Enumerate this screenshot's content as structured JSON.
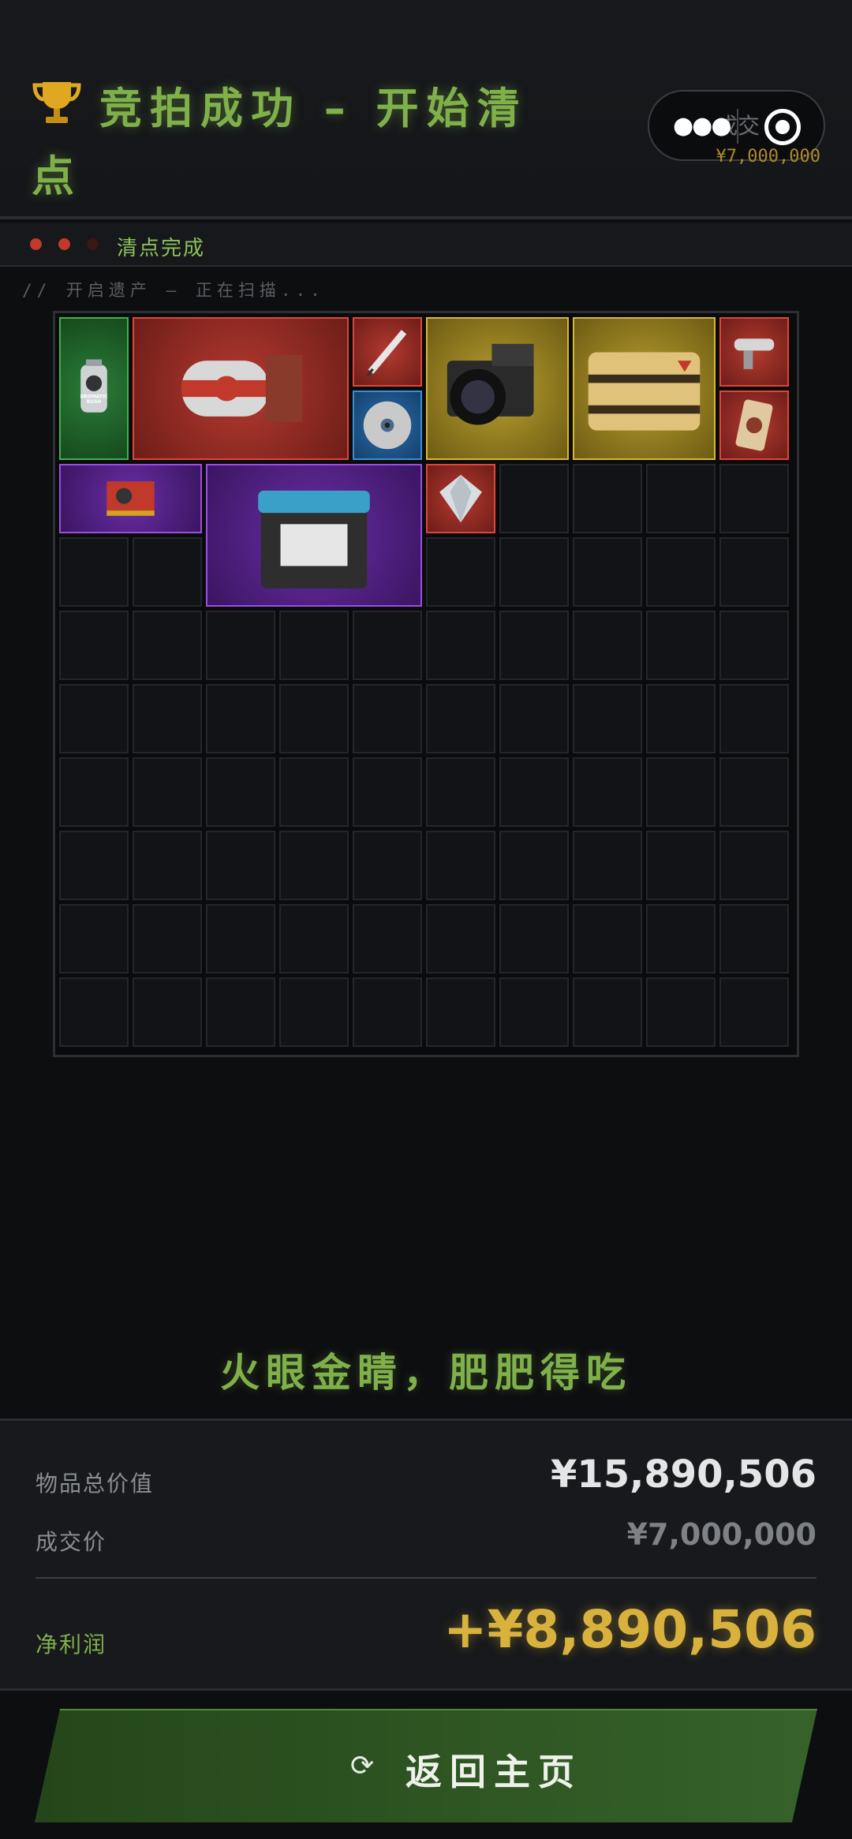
{
  "header": {
    "trophy_icon": "trophy-icon",
    "title": "竞拍成功 – 开始清点",
    "capsule": {
      "more_icon": "more-dots-icon",
      "ghost_text": "成交",
      "close_icon": "target-icon"
    },
    "deal_price_small": "¥7,000,000"
  },
  "status": {
    "dot_colors": [
      "#c0392b",
      "#c0392b",
      "#3a1614"
    ],
    "text": "清点完成"
  },
  "scan_line": "// 开启遗产 – 正在扫描...",
  "grid": {
    "columns": 10,
    "rows": 10,
    "items": [
      {
        "name": "spray-can-item",
        "rarity": "green",
        "col": 0,
        "row": 0,
        "w": 1,
        "h": 2,
        "label": "DROMATIC RUSH"
      },
      {
        "name": "plane-cylinder-item",
        "rarity": "red",
        "col": 1,
        "row": 0,
        "w": 3,
        "h": 2
      },
      {
        "name": "syringe-pen-item",
        "rarity": "red",
        "col": 4,
        "row": 0,
        "w": 1,
        "h": 1
      },
      {
        "name": "cd-disc-item",
        "rarity": "blue",
        "col": 4,
        "row": 1,
        "w": 1,
        "h": 1
      },
      {
        "name": "camera-item",
        "rarity": "gold",
        "col": 5,
        "row": 0,
        "w": 2,
        "h": 2
      },
      {
        "name": "supply-crate-item",
        "rarity": "gold",
        "col": 7,
        "row": 0,
        "w": 2,
        "h": 2
      },
      {
        "name": "tool-item",
        "rarity": "red",
        "col": 9,
        "row": 0,
        "w": 1,
        "h": 1
      },
      {
        "name": "card-item",
        "rarity": "red",
        "col": 9,
        "row": 1,
        "w": 1,
        "h": 1
      },
      {
        "name": "graphics-card-item",
        "rarity": "purple",
        "col": 0,
        "row": 2,
        "w": 2,
        "h": 1
      },
      {
        "name": "car-battery-item",
        "rarity": "purple",
        "col": 2,
        "row": 2,
        "w": 3,
        "h": 2
      },
      {
        "name": "diamond-item",
        "rarity": "red",
        "col": 5,
        "row": 2,
        "w": 1,
        "h": 1
      }
    ]
  },
  "slogan": "火眼金睛，肥肥得吃",
  "summary": {
    "total_label": "物品总价值",
    "total_value": "¥15,890,506",
    "deal_label": "成交价",
    "deal_value": "¥7,000,000",
    "profit_label": "净利润",
    "profit_value": "+¥8,890,506"
  },
  "home_button": {
    "icon": "refresh-icon",
    "label": "返回主页"
  },
  "colors": {
    "accent_green": "#7fb04a",
    "profit_gold": "#d9b23e",
    "deal_gray": "#7e8185"
  }
}
